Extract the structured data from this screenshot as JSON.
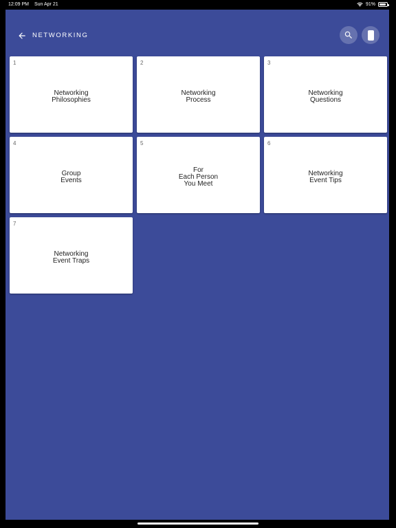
{
  "status_bar": {
    "time": "12:09 PM",
    "date": "Sun Apr 21",
    "battery": "91%",
    "battery_level": 0.91
  },
  "header": {
    "title": "NETWORKING"
  },
  "cards": [
    {
      "number": "1",
      "label": "Networking\nPhilosophies"
    },
    {
      "number": "2",
      "label": "Networking\nProcess"
    },
    {
      "number": "3",
      "label": "Networking\nQuestions"
    },
    {
      "number": "4",
      "label": "Group\nEvents"
    },
    {
      "number": "5",
      "label": "For\nEach Person\nYou Meet"
    },
    {
      "number": "6",
      "label": "Networking\nEvent Tips"
    },
    {
      "number": "7",
      "label": "Networking\nEvent Traps"
    }
  ],
  "colors": {
    "background": "#3c4b99",
    "card": "#ffffff"
  }
}
